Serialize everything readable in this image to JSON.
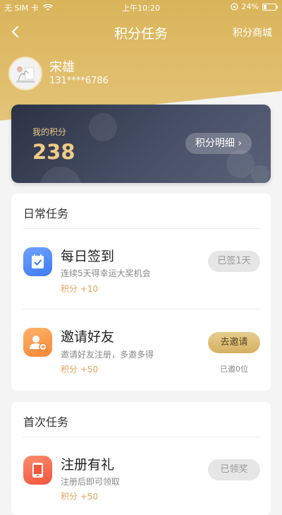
{
  "status_bar": {
    "carrier": "无 SIM 卡",
    "time": "上午10:20",
    "battery": "24%"
  },
  "nav": {
    "title": "积分任务",
    "right_link": "积分商城"
  },
  "profile": {
    "name": "宋雄",
    "phone": "131****6786"
  },
  "points_card": {
    "label": "我的积分",
    "value": "238",
    "detail_button": "积分明细 ›"
  },
  "daily": {
    "title": "日常任务",
    "tasks": [
      {
        "title": "每日签到",
        "desc": "连续5天得幸运大奖机会",
        "points": "积分 +10",
        "button": "已签1天"
      },
      {
        "title": "邀请好友",
        "desc": "邀请好友注册，多邀多得",
        "points": "积分 +50",
        "button": "去邀请",
        "note": "已邀0位"
      }
    ]
  },
  "first": {
    "title": "首次任务",
    "tasks": [
      {
        "title": "注册有礼",
        "desc": "注册后即可领取",
        "points": "积分 +50",
        "button": "已领奖"
      }
    ]
  },
  "colors": {
    "gold": "#d9b45a",
    "card_dark": "#2c3244",
    "points_orange": "#e6a25a"
  }
}
